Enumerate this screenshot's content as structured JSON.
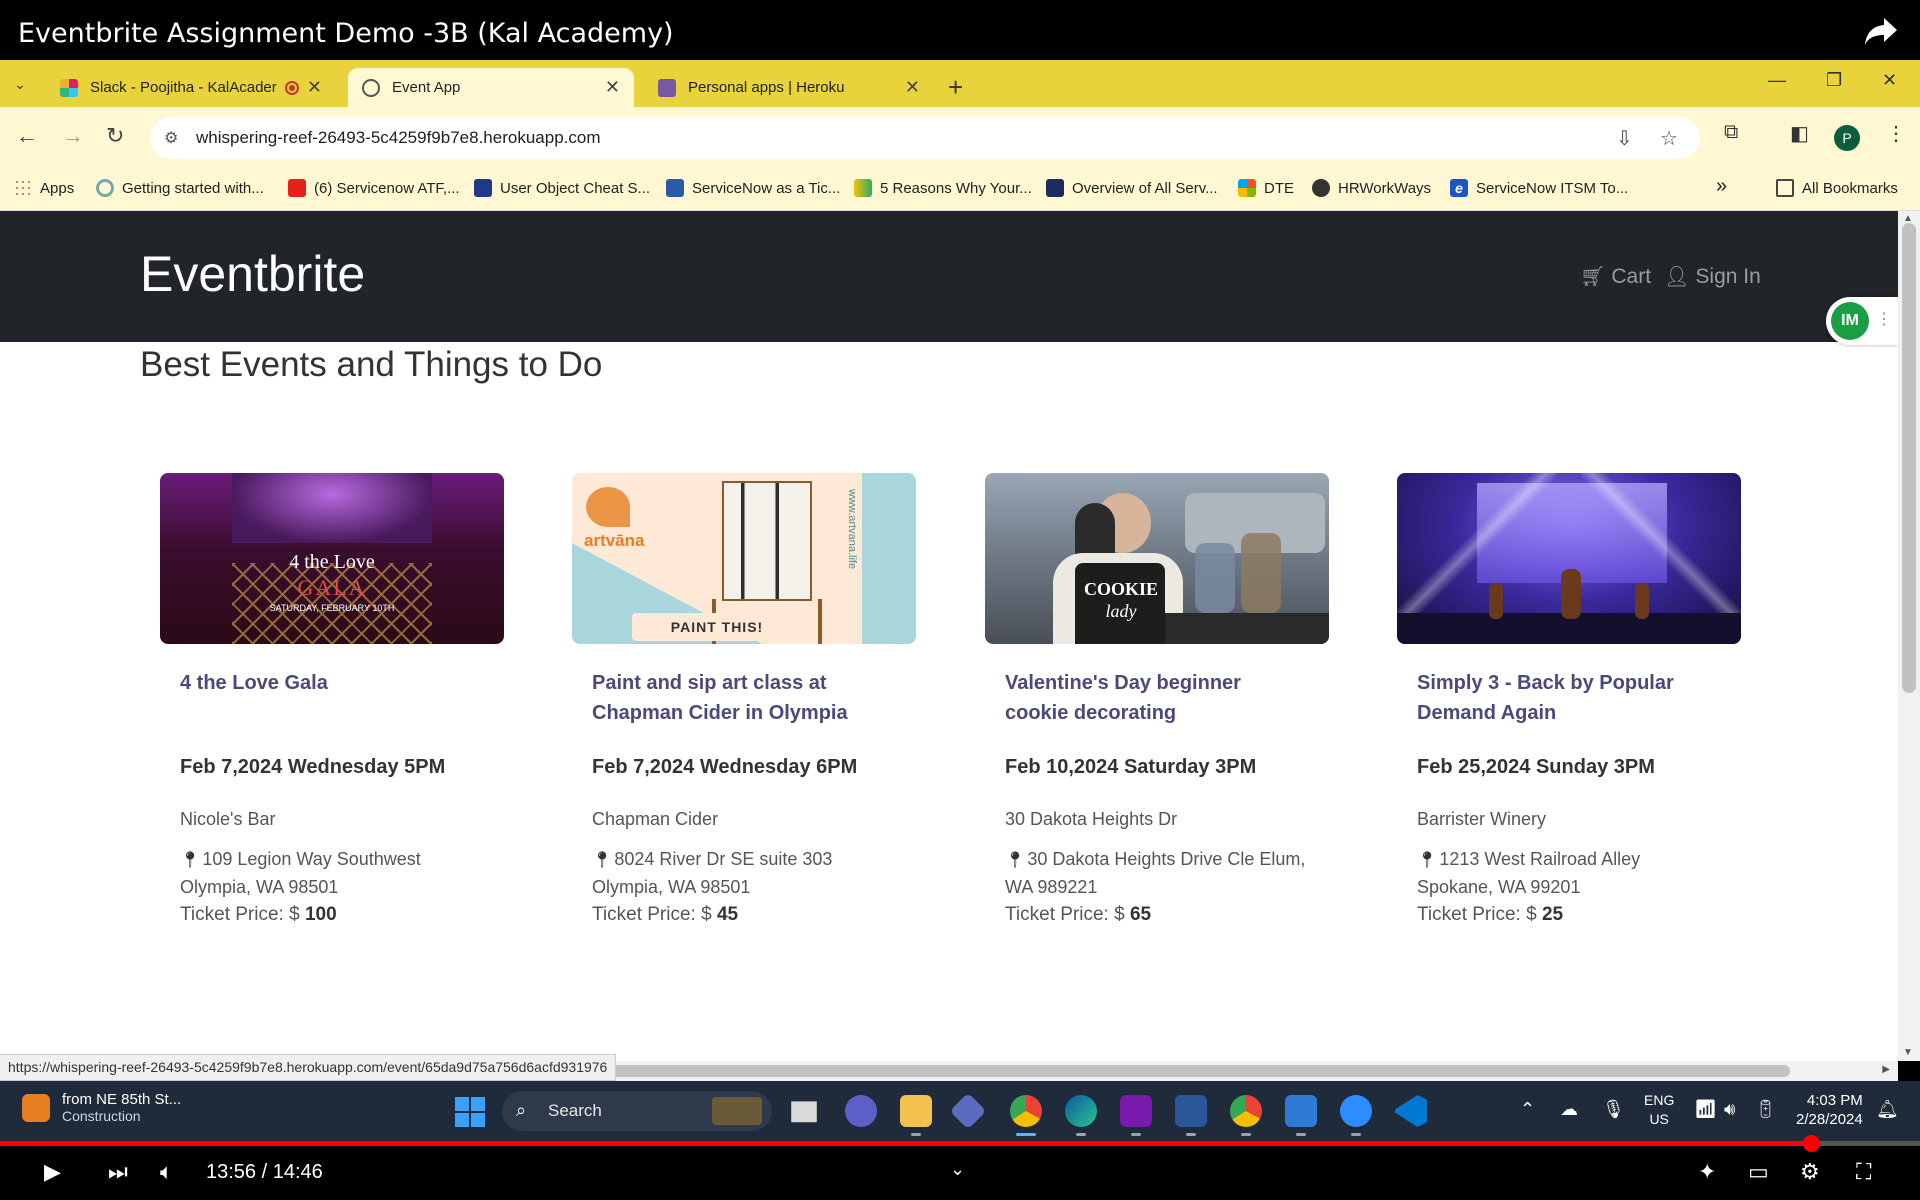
{
  "video": {
    "title": "Eventbrite Assignment Demo -3B (Kal Academy)",
    "time_label": "13:56 / 14:46",
    "progress": 0.943,
    "progress_color": "#ff0000"
  },
  "browser": {
    "tabs": [
      {
        "label": "Slack - Poojitha - KalAcader",
        "icon": "slack-icon",
        "active": false
      },
      {
        "label": "Event App",
        "icon": "globe-icon",
        "active": true
      },
      {
        "label": "Personal apps | Heroku",
        "icon": "heroku-icon",
        "active": false
      }
    ],
    "url": "whispering-reef-26493-5c4259f9b7e8.herokuapp.com",
    "profile_initial": "P",
    "bookmarks": [
      "Apps",
      "Getting started with...",
      "(6) Servicenow ATF,...",
      "User Object Cheat S...",
      "ServiceNow as a Tic...",
      "5 Reasons Why Your...",
      "Overview of All Serv...",
      "DTE",
      "HRWorkWays",
      "ServiceNow ITSM To..."
    ],
    "all_bookmarks": "All Bookmarks",
    "status_url": "https://whispering-reef-26493-5c4259f9b7e8.herokuapp.com/event/65da9d75a756d6acfd931976"
  },
  "site": {
    "brand": "Eventbrite",
    "nav": {
      "cart": "Cart",
      "signin": "Sign In"
    },
    "heading": "Best Events and Things to Do",
    "colors": {
      "navbar": "#212529",
      "title": "#4a4a7a"
    },
    "events": [
      {
        "title": "4 the Love Gala",
        "date": "Feb 7,2024 Wednesday 5PM",
        "venue": "Nicole's Bar",
        "address": "109 Legion Way Southwest Olympia, WA 98501",
        "price_label": "Ticket Price: $",
        "price": "100",
        "image_text": {
          "line1": "4 the Love",
          "line2": "GALA",
          "line3": "SATURDAY, FEBRUARY 10TH"
        }
      },
      {
        "title": "Paint and sip art class at Chapman Cider in Olympia",
        "date": "Feb 7,2024 Wednesday 6PM",
        "venue": "Chapman Cider",
        "address": "8024 River Dr SE suite 303 Olympia, WA 98501",
        "price_label": "Ticket Price: $",
        "price": "45",
        "image_text": {
          "brand": "artvāna",
          "cta": "PAINT THIS!",
          "side": "www.artvana.life"
        }
      },
      {
        "title": "Valentine's Day beginner cookie decorating",
        "date": "Feb 10,2024 Saturday 3PM",
        "venue": "30 Dakota Heights Dr",
        "address": "30 Dakota Heights Drive Cle Elum, WA 989221",
        "price_label": "Ticket Price: $",
        "price": "65",
        "image_text": {
          "apron1": "COOKIE",
          "apron2": "lady"
        }
      },
      {
        "title": "Simply 3 - Back by Popular Demand Again",
        "date": "Feb 25,2024 Sunday 3PM",
        "venue": "Barrister Winery",
        "address": "1213 West Railroad Alley Spokane, WA 99201",
        "price_label": "Ticket Price: $",
        "price": "25",
        "image_text": {}
      }
    ]
  },
  "taskbar": {
    "weather_line1": "from NE 85th St...",
    "weather_line2": "Construction",
    "search": "Search",
    "lang1": "ENG",
    "lang2": "US",
    "time": "4:03 PM",
    "date": "2/28/2024"
  }
}
